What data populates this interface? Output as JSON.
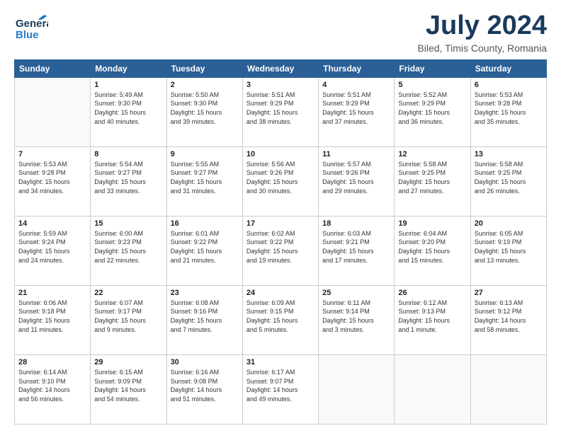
{
  "header": {
    "logo_general": "General",
    "logo_blue": "Blue",
    "month_year": "July 2024",
    "location": "Biled, Timis County, Romania"
  },
  "days_of_week": [
    "Sunday",
    "Monday",
    "Tuesday",
    "Wednesday",
    "Thursday",
    "Friday",
    "Saturday"
  ],
  "weeks": [
    [
      {
        "day": "",
        "info": ""
      },
      {
        "day": "1",
        "info": "Sunrise: 5:49 AM\nSunset: 9:30 PM\nDaylight: 15 hours\nand 40 minutes."
      },
      {
        "day": "2",
        "info": "Sunrise: 5:50 AM\nSunset: 9:30 PM\nDaylight: 15 hours\nand 39 minutes."
      },
      {
        "day": "3",
        "info": "Sunrise: 5:51 AM\nSunset: 9:29 PM\nDaylight: 15 hours\nand 38 minutes."
      },
      {
        "day": "4",
        "info": "Sunrise: 5:51 AM\nSunset: 9:29 PM\nDaylight: 15 hours\nand 37 minutes."
      },
      {
        "day": "5",
        "info": "Sunrise: 5:52 AM\nSunset: 9:29 PM\nDaylight: 15 hours\nand 36 minutes."
      },
      {
        "day": "6",
        "info": "Sunrise: 5:53 AM\nSunset: 9:28 PM\nDaylight: 15 hours\nand 35 minutes."
      }
    ],
    [
      {
        "day": "7",
        "info": "Sunrise: 5:53 AM\nSunset: 9:28 PM\nDaylight: 15 hours\nand 34 minutes."
      },
      {
        "day": "8",
        "info": "Sunrise: 5:54 AM\nSunset: 9:27 PM\nDaylight: 15 hours\nand 33 minutes."
      },
      {
        "day": "9",
        "info": "Sunrise: 5:55 AM\nSunset: 9:27 PM\nDaylight: 15 hours\nand 31 minutes."
      },
      {
        "day": "10",
        "info": "Sunrise: 5:56 AM\nSunset: 9:26 PM\nDaylight: 15 hours\nand 30 minutes."
      },
      {
        "day": "11",
        "info": "Sunrise: 5:57 AM\nSunset: 9:26 PM\nDaylight: 15 hours\nand 29 minutes."
      },
      {
        "day": "12",
        "info": "Sunrise: 5:58 AM\nSunset: 9:25 PM\nDaylight: 15 hours\nand 27 minutes."
      },
      {
        "day": "13",
        "info": "Sunrise: 5:58 AM\nSunset: 9:25 PM\nDaylight: 15 hours\nand 26 minutes."
      }
    ],
    [
      {
        "day": "14",
        "info": "Sunrise: 5:59 AM\nSunset: 9:24 PM\nDaylight: 15 hours\nand 24 minutes."
      },
      {
        "day": "15",
        "info": "Sunrise: 6:00 AM\nSunset: 9:23 PM\nDaylight: 15 hours\nand 22 minutes."
      },
      {
        "day": "16",
        "info": "Sunrise: 6:01 AM\nSunset: 9:22 PM\nDaylight: 15 hours\nand 21 minutes."
      },
      {
        "day": "17",
        "info": "Sunrise: 6:02 AM\nSunset: 9:22 PM\nDaylight: 15 hours\nand 19 minutes."
      },
      {
        "day": "18",
        "info": "Sunrise: 6:03 AM\nSunset: 9:21 PM\nDaylight: 15 hours\nand 17 minutes."
      },
      {
        "day": "19",
        "info": "Sunrise: 6:04 AM\nSunset: 9:20 PM\nDaylight: 15 hours\nand 15 minutes."
      },
      {
        "day": "20",
        "info": "Sunrise: 6:05 AM\nSunset: 9:19 PM\nDaylight: 15 hours\nand 13 minutes."
      }
    ],
    [
      {
        "day": "21",
        "info": "Sunrise: 6:06 AM\nSunset: 9:18 PM\nDaylight: 15 hours\nand 11 minutes."
      },
      {
        "day": "22",
        "info": "Sunrise: 6:07 AM\nSunset: 9:17 PM\nDaylight: 15 hours\nand 9 minutes."
      },
      {
        "day": "23",
        "info": "Sunrise: 6:08 AM\nSunset: 9:16 PM\nDaylight: 15 hours\nand 7 minutes."
      },
      {
        "day": "24",
        "info": "Sunrise: 6:09 AM\nSunset: 9:15 PM\nDaylight: 15 hours\nand 5 minutes."
      },
      {
        "day": "25",
        "info": "Sunrise: 6:11 AM\nSunset: 9:14 PM\nDaylight: 15 hours\nand 3 minutes."
      },
      {
        "day": "26",
        "info": "Sunrise: 6:12 AM\nSunset: 9:13 PM\nDaylight: 15 hours\nand 1 minute."
      },
      {
        "day": "27",
        "info": "Sunrise: 6:13 AM\nSunset: 9:12 PM\nDaylight: 14 hours\nand 58 minutes."
      }
    ],
    [
      {
        "day": "28",
        "info": "Sunrise: 6:14 AM\nSunset: 9:10 PM\nDaylight: 14 hours\nand 56 minutes."
      },
      {
        "day": "29",
        "info": "Sunrise: 6:15 AM\nSunset: 9:09 PM\nDaylight: 14 hours\nand 54 minutes."
      },
      {
        "day": "30",
        "info": "Sunrise: 6:16 AM\nSunset: 9:08 PM\nDaylight: 14 hours\nand 51 minutes."
      },
      {
        "day": "31",
        "info": "Sunrise: 6:17 AM\nSunset: 9:07 PM\nDaylight: 14 hours\nand 49 minutes."
      },
      {
        "day": "",
        "info": ""
      },
      {
        "day": "",
        "info": ""
      },
      {
        "day": "",
        "info": ""
      }
    ]
  ]
}
